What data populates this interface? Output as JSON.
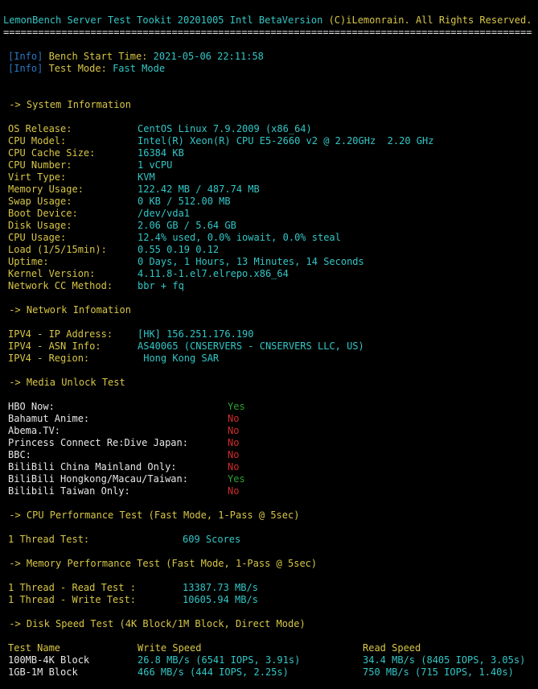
{
  "header": {
    "title": "LemonBench Server Test Tookit 20201005 Intl BetaVersion ",
    "copyright": "(C)iLemonrain. All Rights Reserved.",
    "rule": "==========================================================================================="
  },
  "info": [
    {
      "tag": "[Info]",
      "label": " Bench Start Time: ",
      "value": "2021-05-06 22:11:58"
    },
    {
      "tag": "[Info]",
      "label": " Test Mode: ",
      "value": "Fast Mode"
    }
  ],
  "sections": {
    "system": " -> System Information",
    "network": " -> Network Infomation",
    "media": " -> Media Unlock Test",
    "cpu": " -> CPU Performance Test (Fast Mode, 1-Pass @ 5sec)",
    "memory": " -> Memory Performance Test (Fast Mode, 1-Pass @ 5sec)",
    "disk": " -> Disk Speed Test (4K Block/1M Block, Direct Mode)"
  },
  "system": [
    {
      "label": "OS Release:",
      "value": "CentOS Linux 7.9.2009 (x86_64)"
    },
    {
      "label": "CPU Model:",
      "value": "Intel(R) Xeon(R) CPU E5-2660 v2 @ 2.20GHz  2.20 GHz"
    },
    {
      "label": "CPU Cache Size:",
      "value": "16384 KB"
    },
    {
      "label": "CPU Number:",
      "value": "1 vCPU"
    },
    {
      "label": "Virt Type:",
      "value": "KVM"
    },
    {
      "label": "Memory Usage:",
      "value": "122.42 MB / 487.74 MB"
    },
    {
      "label": "Swap Usage:",
      "value": "0 KB / 512.00 MB"
    },
    {
      "label": "Boot Device:",
      "value": "/dev/vda1"
    },
    {
      "label": "Disk Usage:",
      "value": "2.06 GB / 5.64 GB"
    },
    {
      "label": "CPU Usage:",
      "value": "12.4% used, 0.0% iowait, 0.0% steal"
    },
    {
      "label": "Load (1/5/15min):",
      "value": "0.55 0.19 0.12"
    },
    {
      "label": "Uptime:",
      "value": "0 Days, 1 Hours, 13 Minutes, 14 Seconds"
    },
    {
      "label": "Kernel Version:",
      "value": "4.11.8-1.el7.elrepo.x86_64"
    },
    {
      "label": "Network CC Method:",
      "value": "bbr + fq"
    }
  ],
  "network": [
    {
      "label": "IPV4 - IP Address:",
      "value": "[HK] 156.251.176.190"
    },
    {
      "label": "IPV4 - ASN Info:",
      "value": "AS40065 (CNSERVERS - CNSERVERS LLC, US)"
    },
    {
      "label": "IPV4 - Region:",
      "value": " Hong Kong SAR"
    }
  ],
  "media": [
    {
      "label": "HBO Now:",
      "value": "Yes",
      "status_color": "#2ea02e"
    },
    {
      "label": "Bahamut Anime:",
      "value": "No",
      "status_color": "#d22c2c"
    },
    {
      "label": "Abema.TV:",
      "value": "No",
      "status_color": "#d22c2c"
    },
    {
      "label": "Princess Connect Re:Dive Japan:",
      "value": "No",
      "status_color": "#d22c2c"
    },
    {
      "label": "BBC:",
      "value": "No",
      "status_color": "#d22c2c"
    },
    {
      "label": "BiliBili China Mainland Only:",
      "value": "No",
      "status_color": "#d22c2c"
    },
    {
      "label": "BiliBili Hongkong/Macau/Taiwan:",
      "value": "Yes",
      "status_color": "#2ea02e"
    },
    {
      "label": "Bilibili Taiwan Only:",
      "value": "No",
      "status_color": "#d22c2c"
    }
  ],
  "cpu": {
    "label": "1 Thread Test:",
    "value": "609 Scores"
  },
  "memory": [
    {
      "label": "1 Thread - Read Test :",
      "value": "13387.73 MB/s"
    },
    {
      "label": "1 Thread - Write Test:",
      "value": "10605.94 MB/s"
    }
  ],
  "disk": {
    "headers": [
      "Test Name",
      "Write Speed",
      "Read Speed"
    ],
    "rows": [
      {
        "name": "100MB-4K Block",
        "write": "26.8 MB/s (6541 IOPS, 3.91s)",
        "read": "34.4 MB/s (8405 IOPS, 3.05s)"
      },
      {
        "name": "1GB-1M Block",
        "write": "466 MB/s (444 IOPS, 2.25s)",
        "read": "750 MB/s (715 IOPS, 1.40s)"
      }
    ]
  }
}
